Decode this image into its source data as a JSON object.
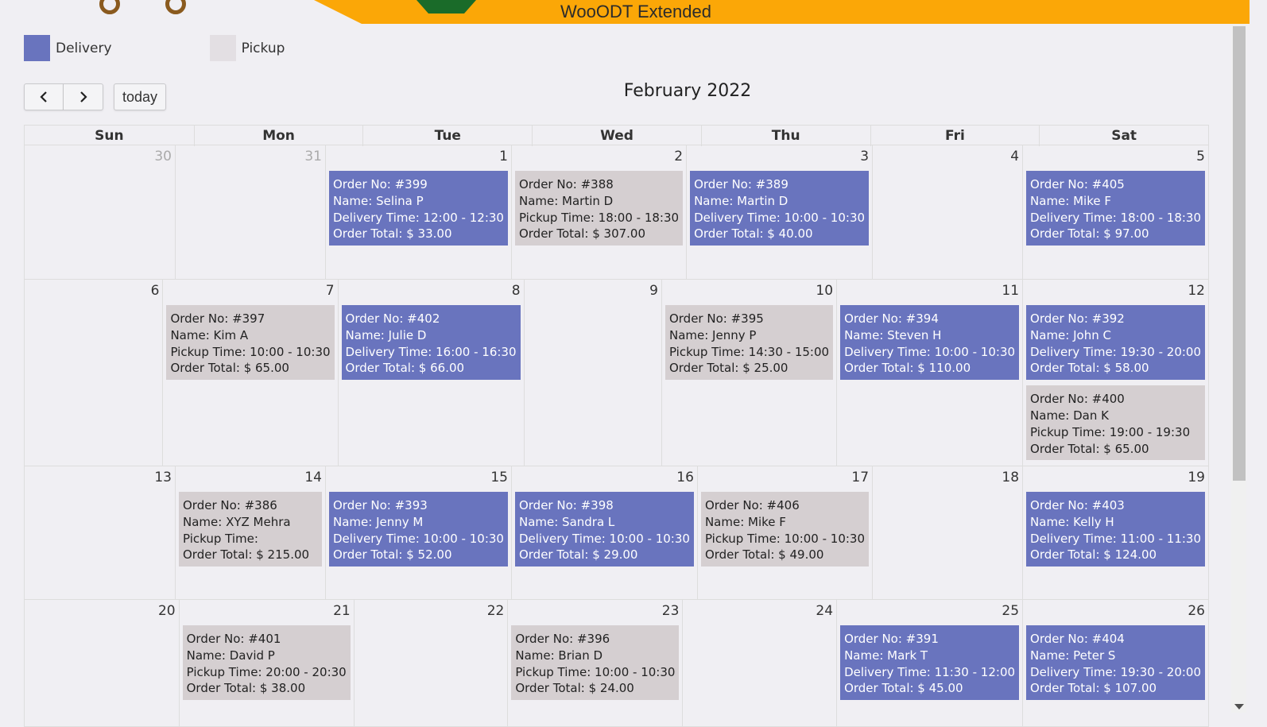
{
  "banner": {
    "title": "WooODT Extended"
  },
  "legend": [
    {
      "label": "Delivery",
      "color": "#6974be"
    },
    {
      "label": "Pickup",
      "color": "#e3dfe3"
    }
  ],
  "toolbar": {
    "prev_icon": "chevron-left-icon",
    "next_icon": "chevron-right-icon",
    "today_label": "today"
  },
  "title": "February 2022",
  "days_of_week": [
    "Sun",
    "Mon",
    "Tue",
    "Wed",
    "Thu",
    "Fri",
    "Sat"
  ],
  "weeks": [
    {
      "height": 0,
      "days": [
        {
          "num": "30",
          "other": true,
          "events": []
        },
        {
          "num": "31",
          "other": true,
          "events": []
        },
        {
          "num": "1",
          "events": [
            {
              "type": "delivery",
              "lines": [
                "Order No: #399",
                "Name: Selina P",
                "Delivery Time: 12:00 - 12:30",
                "Order Total: $ 33.00"
              ]
            }
          ]
        },
        {
          "num": "2",
          "events": [
            {
              "type": "pickup",
              "lines": [
                "Order No: #388",
                "Name: Martin D",
                "Pickup Time: 18:00 - 18:30",
                "Order Total: $ 307.00"
              ]
            }
          ]
        },
        {
          "num": "3",
          "events": [
            {
              "type": "delivery",
              "lines": [
                "Order No: #389",
                "Name: Martin D",
                "Delivery Time: 10:00 - 10:30",
                "Order Total: $ 40.00"
              ]
            }
          ]
        },
        {
          "num": "4",
          "events": []
        },
        {
          "num": "5",
          "events": [
            {
              "type": "delivery",
              "lines": [
                "Order No: #405",
                "Name: Mike F",
                "Delivery Time: 18:00 - 18:30",
                "Order Total: $ 97.00"
              ]
            }
          ]
        }
      ]
    },
    {
      "days": [
        {
          "num": "6",
          "events": []
        },
        {
          "num": "7",
          "events": [
            {
              "type": "pickup",
              "lines": [
                "Order No: #397",
                "Name: Kim A",
                "Pickup Time: 10:00 - 10:30",
                "Order Total: $ 65.00"
              ]
            }
          ]
        },
        {
          "num": "8",
          "events": [
            {
              "type": "delivery",
              "lines": [
                "Order No: #402",
                "Name: Julie D",
                "Delivery Time: 16:00 - 16:30",
                "Order Total: $ 66.00"
              ]
            }
          ]
        },
        {
          "num": "9",
          "events": []
        },
        {
          "num": "10",
          "events": [
            {
              "type": "pickup",
              "lines": [
                "Order No: #395",
                "Name: Jenny P",
                "Pickup Time: 14:30 - 15:00",
                "Order Total: $ 25.00"
              ]
            }
          ]
        },
        {
          "num": "11",
          "events": [
            {
              "type": "delivery",
              "lines": [
                "Order No: #394",
                "Name: Steven H",
                "Delivery Time: 10:00 - 10:30",
                "Order Total: $ 110.00"
              ]
            }
          ]
        },
        {
          "num": "12",
          "events": [
            {
              "type": "delivery",
              "lines": [
                "Order No: #392",
                "Name: John C",
                "Delivery Time: 19:30 - 20:00",
                "Order Total: $ 58.00"
              ]
            },
            {
              "type": "pickup",
              "lines": [
                "Order No: #400",
                "Name: Dan K",
                "Pickup Time: 19:00 - 19:30",
                "Order Total: $ 65.00"
              ]
            }
          ]
        }
      ]
    },
    {
      "days": [
        {
          "num": "13",
          "events": []
        },
        {
          "num": "14",
          "events": [
            {
              "type": "pickup",
              "lines": [
                "Order No: #386",
                "Name: XYZ Mehra",
                "Pickup Time:",
                "Order Total: $ 215.00"
              ]
            }
          ]
        },
        {
          "num": "15",
          "events": [
            {
              "type": "delivery",
              "lines": [
                "Order No: #393",
                "Name: Jenny M",
                "Delivery Time: 10:00 - 10:30",
                "Order Total: $ 52.00"
              ]
            }
          ]
        },
        {
          "num": "16",
          "events": [
            {
              "type": "delivery",
              "lines": [
                "Order No: #398",
                "Name: Sandra L",
                "Delivery Time: 10:00 - 10:30",
                "Order Total: $ 29.00"
              ]
            }
          ]
        },
        {
          "num": "17",
          "events": [
            {
              "type": "pickup",
              "lines": [
                "Order No: #406",
                "Name: Mike F",
                "Pickup Time: 10:00 - 10:30",
                "Order Total: $ 49.00"
              ]
            }
          ]
        },
        {
          "num": "18",
          "events": []
        },
        {
          "num": "19",
          "events": [
            {
              "type": "delivery",
              "lines": [
                "Order No: #403",
                "Name: Kelly H",
                "Delivery Time: 11:00 - 11:30",
                "Order Total: $ 124.00"
              ]
            }
          ]
        }
      ]
    },
    {
      "days": [
        {
          "num": "20",
          "events": []
        },
        {
          "num": "21",
          "events": [
            {
              "type": "pickup",
              "lines": [
                "Order No: #401",
                "Name: David P",
                "Pickup Time: 20:00 - 20:30",
                "Order Total: $ 38.00"
              ]
            }
          ]
        },
        {
          "num": "22",
          "events": []
        },
        {
          "num": "23",
          "events": [
            {
              "type": "pickup",
              "lines": [
                "Order No: #396",
                "Name: Brian D",
                "Pickup Time: 10:00 - 10:30",
                "Order Total: $ 24.00"
              ]
            }
          ]
        },
        {
          "num": "24",
          "events": []
        },
        {
          "num": "25",
          "events": [
            {
              "type": "delivery",
              "lines": [
                "Order No: #391",
                "Name: Mark T",
                "Delivery Time: 11:30 - 12:00",
                "Order Total: $ 45.00"
              ]
            }
          ]
        },
        {
          "num": "26",
          "events": [
            {
              "type": "delivery",
              "lines": [
                "Order No: #404",
                "Name: Peter S",
                "Delivery Time: 19:30 - 20:00",
                "Order Total: $ 107.00"
              ]
            }
          ]
        }
      ]
    }
  ]
}
